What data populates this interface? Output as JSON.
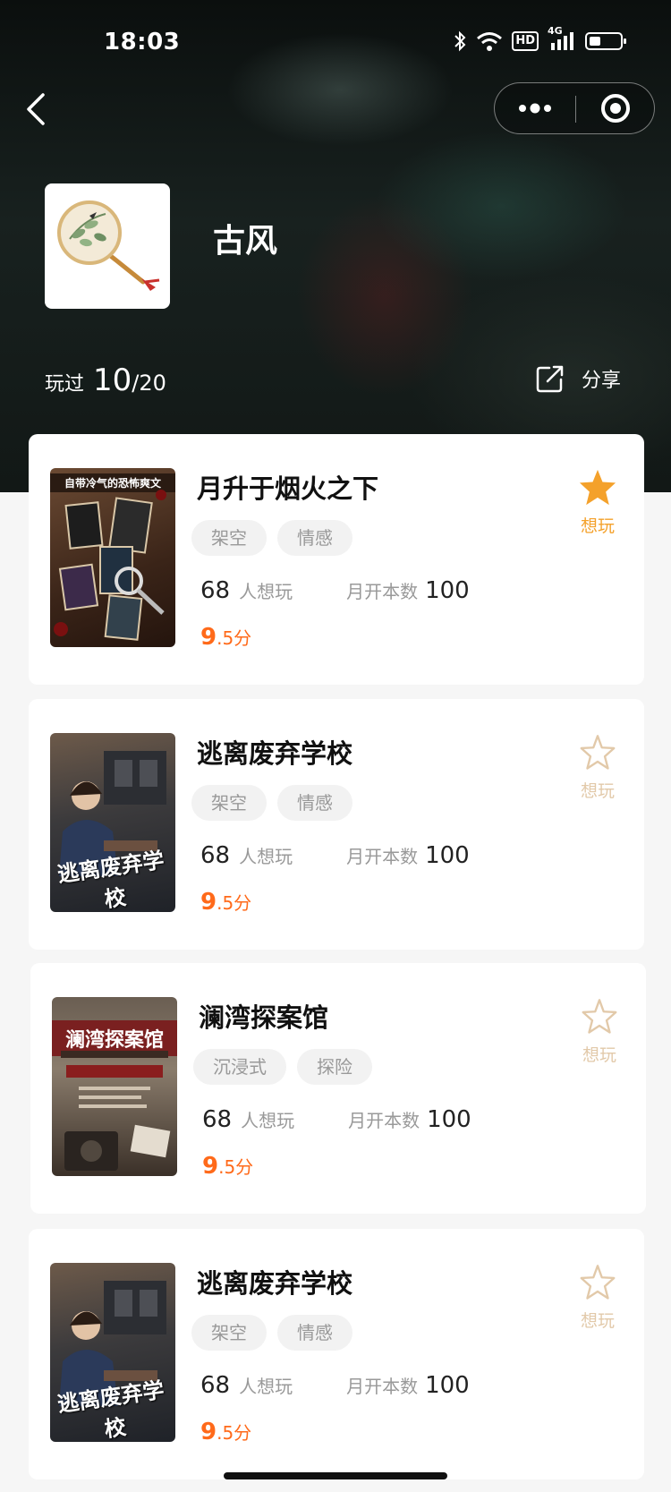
{
  "status_bar": {
    "time": "18:03",
    "hd": "HD",
    "network": "4G"
  },
  "nav": {
    "back_icon": "chevron-left-icon",
    "more_icon": "more-dots-icon",
    "close_icon": "target-close-icon"
  },
  "topic": {
    "title": "古风",
    "cover_icon": "round-fan-icon"
  },
  "progress": {
    "label": "玩过",
    "played": "10",
    "total": "/20"
  },
  "share": {
    "label": "分享",
    "icon": "share-icon"
  },
  "colors": {
    "accent": "#ff6a1a",
    "star_active": "#f4a12b",
    "star_inactive": "#e2c9a9",
    "tag_bg": "#f2f2f2"
  },
  "scripts": [
    {
      "name": "月升于烟火之下",
      "tags": [
        "架空",
        "情感"
      ],
      "want_count": "68",
      "want_label": "人想玩",
      "monthly_label": "月开本数",
      "monthly_count": "100",
      "score_int": "9",
      "score_dec": ".5分",
      "want_text": "想玩",
      "wanted": true,
      "poster_text": "自带冷气的恐怖爽文"
    },
    {
      "name": "逃离废弃学校",
      "tags": [
        "架空",
        "情感"
      ],
      "want_count": "68",
      "want_label": "人想玩",
      "monthly_label": "月开本数",
      "monthly_count": "100",
      "score_int": "9",
      "score_dec": ".5分",
      "want_text": "想玩",
      "wanted": false,
      "poster_text": "逃离废弃学校"
    },
    {
      "name": "澜湾探案馆",
      "tags": [
        "沉浸式",
        "探险"
      ],
      "want_count": "68",
      "want_label": "人想玩",
      "monthly_label": "月开本数",
      "monthly_count": "100",
      "score_int": "9",
      "score_dec": ".5分",
      "want_text": "想玩",
      "wanted": false,
      "poster_text": "澜湾探案馆"
    },
    {
      "name": "逃离废弃学校",
      "tags": [
        "架空",
        "情感"
      ],
      "want_count": "68",
      "want_label": "人想玩",
      "monthly_label": "月开本数",
      "monthly_count": "100",
      "score_int": "9",
      "score_dec": ".5分",
      "want_text": "想玩",
      "wanted": false,
      "poster_text": "逃离废弃学校"
    }
  ]
}
